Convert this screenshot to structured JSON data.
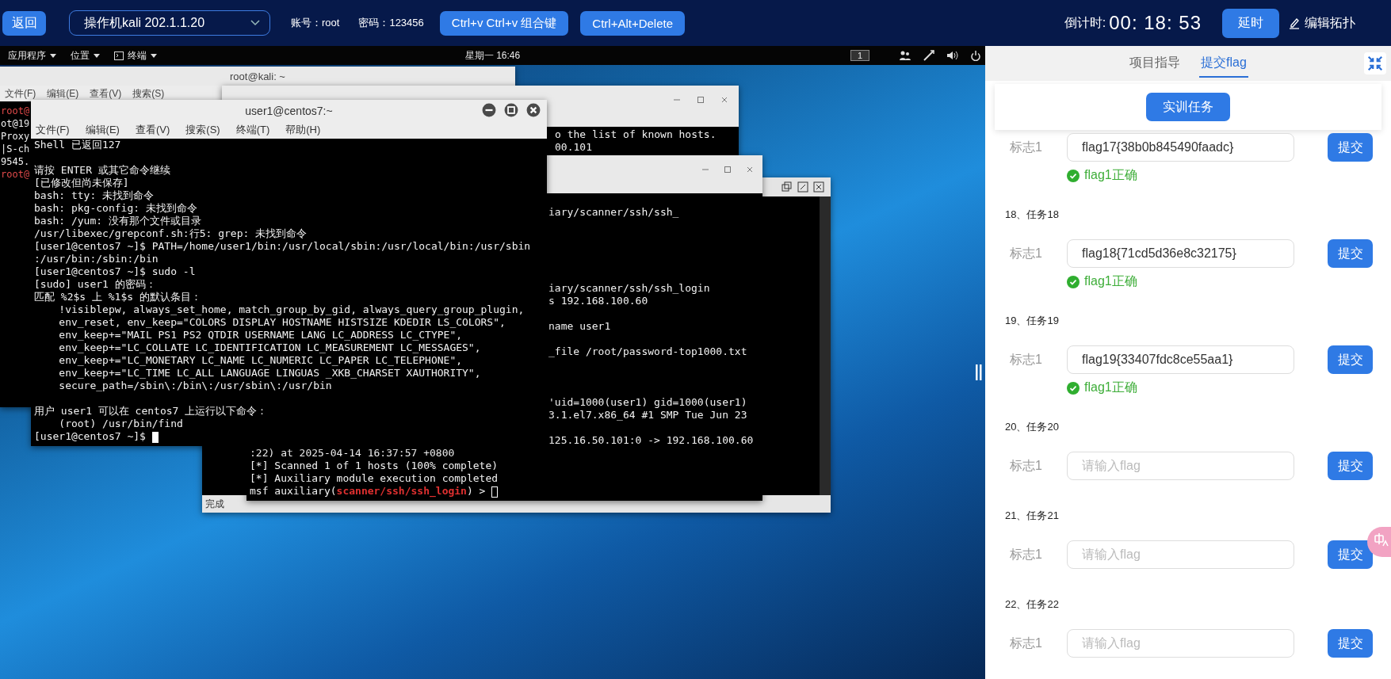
{
  "topbar": {
    "back_button": "返回",
    "machine_select": "操作机kali 202.1.1.20",
    "account": "账号：root",
    "password": "密码：123456",
    "buttons": [
      "Ctrl+v  Ctrl+v 组合键",
      "Ctrl+Alt+Delete"
    ],
    "countdown_label": "倒计时:",
    "countdown": "00: 18: 53",
    "delay_button": "延时",
    "edit_topology": "编辑拓扑"
  },
  "vm": {
    "gnome_bar": {
      "menus": [
        "应用程序",
        "位置",
        "终端"
      ],
      "clock": "星期一 16:46",
      "workspace": "1"
    },
    "back_window": {
      "title": "root@kali: ~",
      "menu": [
        "文件(F)",
        "编辑(E)",
        "查看(V)",
        "搜索(S)"
      ],
      "lines": [
        {
          "text": "root@",
          "kind": "prompt"
        },
        {
          "text": "ot@19",
          "kind": "output"
        },
        {
          "text": "Proxy",
          "kind": "output"
        },
        {
          "text": "|S-ch",
          "kind": "output"
        },
        {
          "text": "9545.",
          "kind": "output"
        },
        {
          "text": "root@",
          "kind": "prompt"
        }
      ]
    },
    "known_hosts_window": {
      "lines": [
        {
          "text": "o the list of known hosts.",
          "kind": "cut"
        },
        {
          "text": "00.101",
          "kind": "cut"
        }
      ]
    },
    "status_window": {
      "status": "完成"
    },
    "msf_window": {
      "lines": [
        {
          "kind": "blank"
        },
        {
          "text": "iary/scanner/ssh/ssh_",
          "kind": "cut"
        },
        {
          "kind": "blank"
        },
        {
          "kind": "blank"
        },
        {
          "kind": "blank"
        },
        {
          "kind": "blank"
        },
        {
          "kind": "blank"
        },
        {
          "text": "iary/scanner/ssh/ssh_login",
          "kind": "cut"
        },
        {
          "text": "s 192.168.100.60",
          "kind": "cut"
        },
        {
          "kind": "blank"
        },
        {
          "text": "name user1",
          "kind": "cut"
        },
        {
          "kind": "blank"
        },
        {
          "text": "_file /root/password-top1000.txt",
          "kind": "cut"
        },
        {
          "kind": "blank"
        },
        {
          "kind": "blank"
        },
        {
          "kind": "blank"
        },
        {
          "text": "'uid=1000(user1) gid=1000(user1)",
          "kind": "cut"
        },
        {
          "text": "3.1.el7.x86_64 #1 SMP Tue Jun 23",
          "kind": "cut"
        },
        {
          "kind": "blank"
        },
        {
          "text": "125.16.50.101:0 -> 192.168.100.60",
          "kind": "cut"
        },
        {
          "text": ":22) at 2025-04-14 16:37:57 +0800",
          "kind": "full"
        },
        {
          "text": "[*] Scanned 1 of 1 hosts (100% complete)",
          "kind": "full"
        },
        {
          "text": "[*] Auxiliary module execution completed",
          "kind": "full"
        },
        {
          "text": "msf auxiliary(**scanner/ssh/ssh_login**) > ",
          "kind": "full",
          "cursor": true
        }
      ]
    },
    "centos_window": {
      "title": "user1@centos7:~",
      "menu": [
        "文件(F)",
        "编辑(E)",
        "查看(V)",
        "搜索(S)",
        "终端(T)",
        "帮助(H)"
      ],
      "lines": [
        {
          "text": "Shell 已返回127",
          "kind": "full"
        },
        {
          "kind": "blank"
        },
        {
          "text": "请按 ENTER 或其它命令继续",
          "kind": "full"
        },
        {
          "text": "[已修改但尚未保存]",
          "kind": "full"
        },
        {
          "text": "bash: tty: 未找到命令",
          "kind": "full"
        },
        {
          "text": "bash: pkg-config: 未找到命令",
          "kind": "full"
        },
        {
          "text": "bash: /yum: 没有那个文件或目录",
          "kind": "full"
        },
        {
          "text": "/usr/libexec/grepconf.sh:行5: grep: 未找到命令",
          "kind": "full"
        },
        {
          "text": "[user1@centos7 ~]$ PATH=/home/user1/bin:/usr/local/sbin:/usr/local/bin:/usr/sbin",
          "kind": "full"
        },
        {
          "text": ":/usr/bin:/sbin:/bin",
          "kind": "full"
        },
        {
          "text": "[user1@centos7 ~]$ sudo -l",
          "kind": "full"
        },
        {
          "text": "[sudo] user1 的密码：",
          "kind": "full"
        },
        {
          "text": "匹配 %2$s 上 %1$s 的默认条目：",
          "kind": "full"
        },
        {
          "text": "    !visiblepw, always_set_home, match_group_by_gid, always_query_group_plugin,",
          "kind": "full"
        },
        {
          "text": "    env_reset, env_keep=\"COLORS DISPLAY HOSTNAME HISTSIZE KDEDIR LS_COLORS\",",
          "kind": "full"
        },
        {
          "text": "    env_keep+=\"MAIL PS1 PS2 QTDIR USERNAME LANG LC_ADDRESS LC_CTYPE\",",
          "kind": "full"
        },
        {
          "text": "    env_keep+=\"LC_COLLATE LC_IDENTIFICATION LC_MEASUREMENT LC_MESSAGES\",",
          "kind": "full"
        },
        {
          "text": "    env_keep+=\"LC_MONETARY LC_NAME LC_NUMERIC LC_PAPER LC_TELEPHONE\",",
          "kind": "full"
        },
        {
          "text": "    env_keep+=\"LC_TIME LC_ALL LANGUAGE LINGUAS _XKB_CHARSET XAUTHORITY\",",
          "kind": "full"
        },
        {
          "text": "    secure_path=/sbin\\:/bin\\:/usr/sbin\\:/usr/bin",
          "kind": "full"
        },
        {
          "kind": "blank"
        },
        {
          "text": "用户 user1 可以在 centos7 上运行以下命令：",
          "kind": "full"
        },
        {
          "text": "    (root) /usr/bin/find",
          "kind": "full"
        },
        {
          "text": "[user1@centos7 ~]$ ",
          "kind": "full",
          "cursor": true
        }
      ]
    }
  },
  "panel": {
    "tabs": [
      {
        "label": "项目指导",
        "selected": false
      },
      {
        "label": "提交flag",
        "selected": true
      }
    ],
    "task_button": "实训任务",
    "tasks": [
      {
        "label": "标志1",
        "value": "flag17{38b0b845490faadc}",
        "button": "提交",
        "result": "flag1正确"
      },
      {
        "heading": "18、任务18",
        "label": "标志1",
        "value": "flag18{71cd5d36e8c32175}",
        "button": "提交",
        "result": "flag1正确"
      },
      {
        "heading": "19、任务19",
        "label": "标志1",
        "value": "flag19{33407fdc8ce55aa1}",
        "button": "提交",
        "result": "flag1正确"
      },
      {
        "heading": "20、任务20",
        "label": "标志1",
        "placeholder": "请输入flag",
        "button": "提交"
      },
      {
        "heading": "21、任务21",
        "label": "标志1",
        "placeholder": "请输入flag",
        "button": "提交"
      },
      {
        "heading": "22、任务22",
        "label": "标志1",
        "placeholder": "请输入flag",
        "button": "提交"
      }
    ]
  }
}
